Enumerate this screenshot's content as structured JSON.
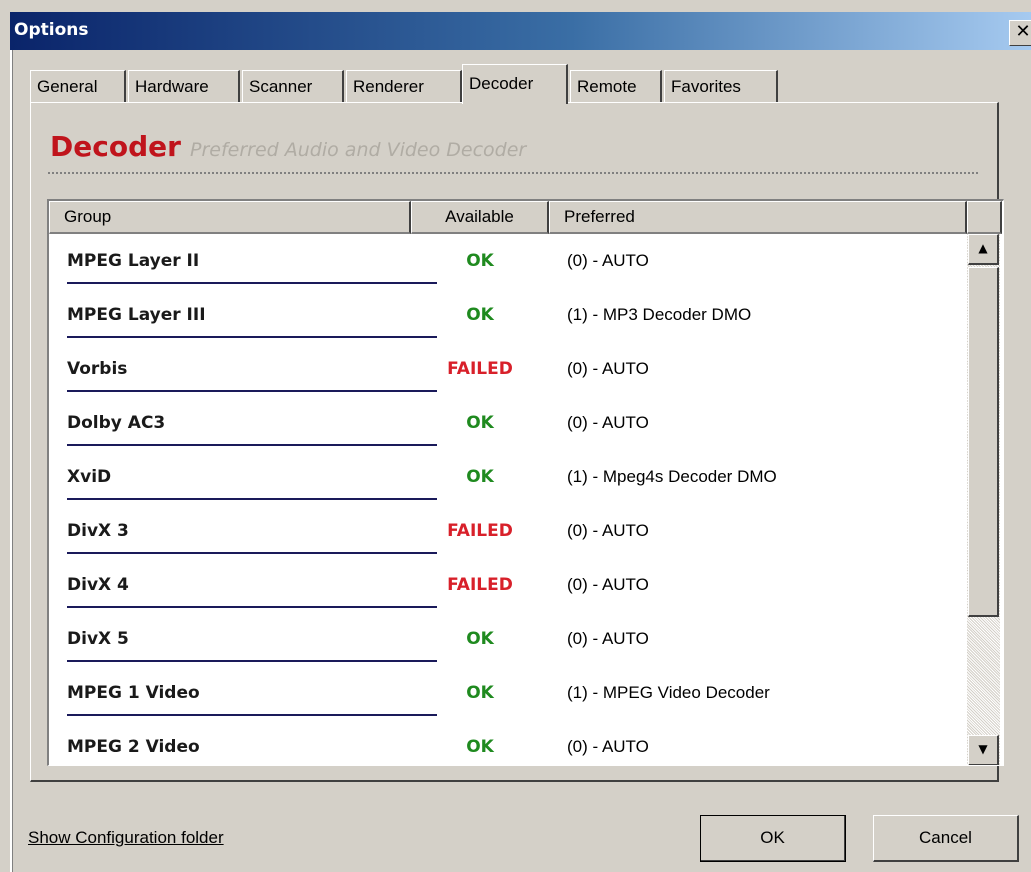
{
  "window": {
    "title": "Options",
    "close_glyph": "✕"
  },
  "tabs": [
    {
      "label": "General"
    },
    {
      "label": "Hardware"
    },
    {
      "label": "Scanner"
    },
    {
      "label": "Renderer"
    },
    {
      "label": "Decoder",
      "active": true
    },
    {
      "label": "Remote"
    },
    {
      "label": "Favorites"
    }
  ],
  "panel": {
    "title": "Decoder",
    "subtitle": "Preferred Audio and Video Decoder"
  },
  "table": {
    "columns": {
      "group": "Group",
      "available": "Available",
      "preferred": "Preferred"
    },
    "rows": [
      {
        "group": "MPEG Layer II",
        "available": "OK",
        "preferred": "(0) - AUTO"
      },
      {
        "group": "MPEG Layer III",
        "available": "OK",
        "preferred": "(1) - MP3 Decoder DMO"
      },
      {
        "group": "Vorbis",
        "available": "FAILED",
        "preferred": "(0) - AUTO"
      },
      {
        "group": "Dolby AC3",
        "available": "OK",
        "preferred": "(0) - AUTO"
      },
      {
        "group": "XviD",
        "available": "OK",
        "preferred": "(1) - Mpeg4s Decoder DMO"
      },
      {
        "group": "DivX 3",
        "available": "FAILED",
        "preferred": "(0) - AUTO"
      },
      {
        "group": "DivX 4",
        "available": "FAILED",
        "preferred": "(0) - AUTO"
      },
      {
        "group": "DivX 5",
        "available": "OK",
        "preferred": "(0) - AUTO"
      },
      {
        "group": "MPEG 1 Video",
        "available": "OK",
        "preferred": "(1) - MPEG Video Decoder"
      },
      {
        "group": "MPEG 2 Video",
        "available": "OK",
        "preferred": "(0) - AUTO"
      }
    ]
  },
  "scrollbar": {
    "up_glyph": "▲",
    "down_glyph": "▼"
  },
  "footer": {
    "config_link": "Show Configuration folder",
    "ok_label": "OK",
    "cancel_label": "Cancel"
  },
  "colors": {
    "ok": "#1f8a1f",
    "failed": "#d8202a",
    "heading": "#c0141c",
    "titlebar_start": "#0a246a"
  }
}
